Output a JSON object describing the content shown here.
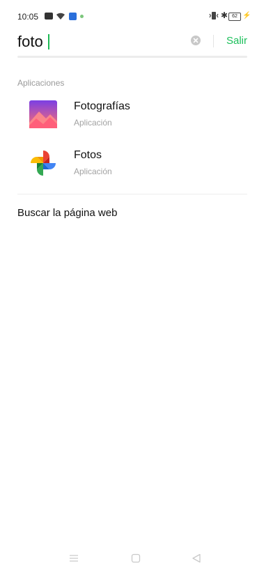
{
  "status_bar": {
    "time": "10:05",
    "battery": "62"
  },
  "search": {
    "query": "foto",
    "exit_label": "Salir"
  },
  "results": {
    "section_header": "Aplicaciones",
    "apps": [
      {
        "name": "Fotografías",
        "subtitle": "Aplicación",
        "icon": "photos-gallery-icon"
      },
      {
        "name": "Fotos",
        "subtitle": "Aplicación",
        "icon": "google-photos-pinwheel-icon"
      }
    ]
  },
  "web_search_label": "Buscar la página web",
  "colors": {
    "accent": "#1bbf5a",
    "gallery_gradient_top": "#7b3fe4",
    "gallery_gradient_bottom": "#ff6f6f"
  }
}
